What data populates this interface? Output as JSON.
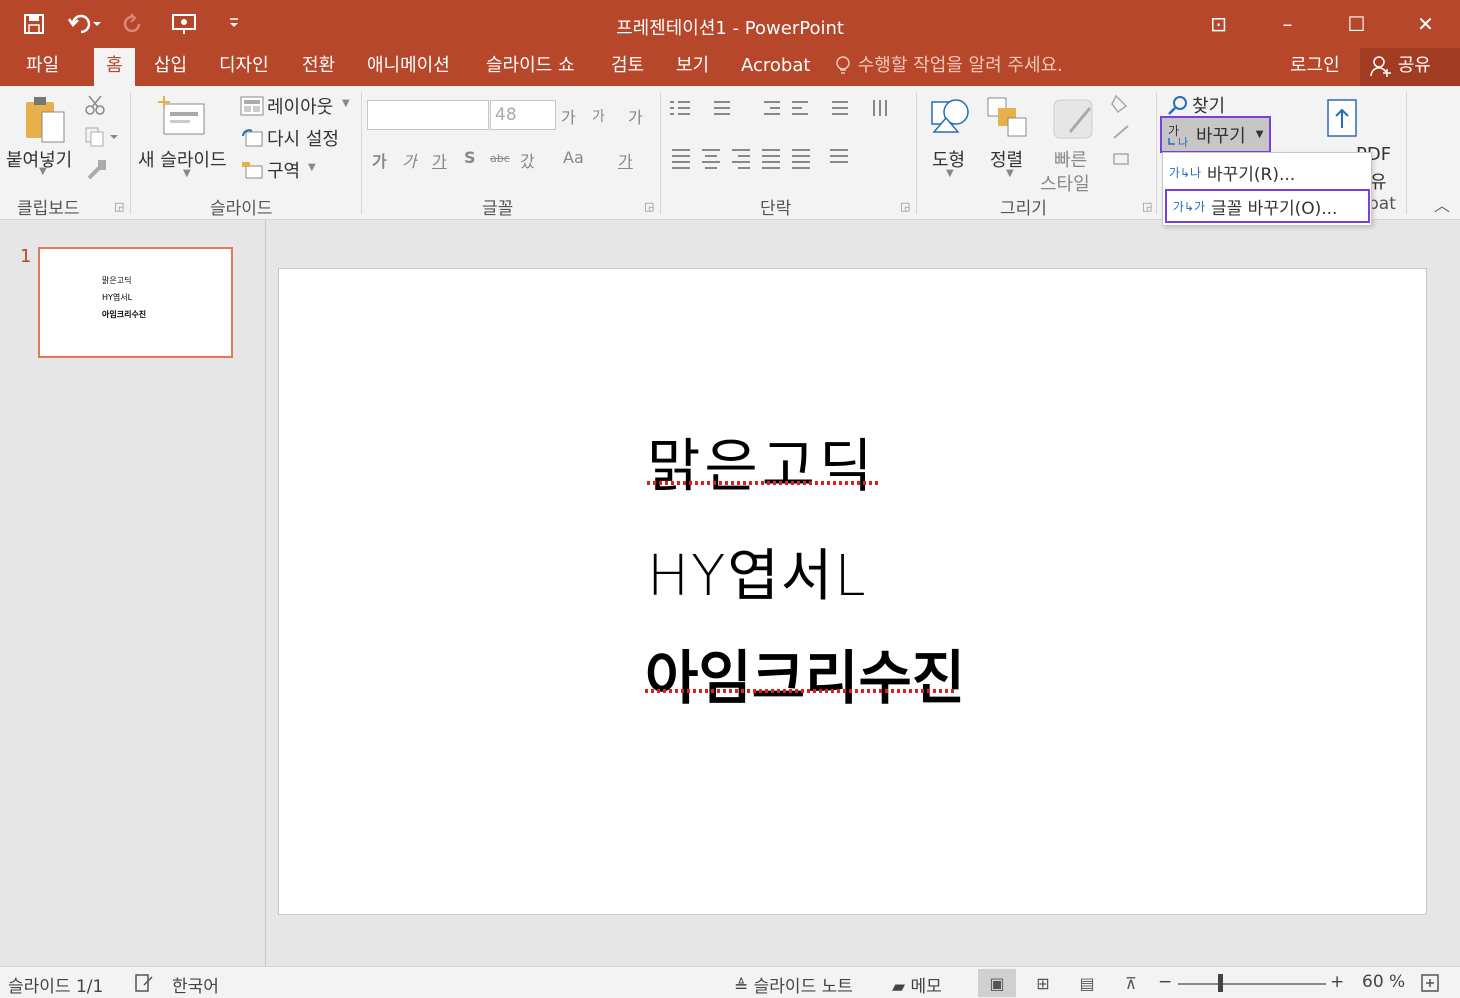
{
  "window": {
    "title": "프레젠테이션1 - PowerPoint",
    "min": "–",
    "max": "☐",
    "close": "✕",
    "ribbon_display": "⊡"
  },
  "tabs": [
    "파일",
    "홈",
    "삽입",
    "디자인",
    "전환",
    "애니메이션",
    "슬라이드 쇼",
    "검토",
    "보기",
    "Acrobat"
  ],
  "active_tab": "홈",
  "tell_me": "수행할 작업을 알려 주세요.",
  "login": "로그인",
  "share": "공유",
  "ribbon": {
    "clipboard": {
      "paste": "붙여넣기",
      "label": "클립보드"
    },
    "slides": {
      "new_slide": "새 슬라이드",
      "layout": "레이아웃",
      "reset": "다시 설정",
      "section": "구역",
      "label": "슬라이드"
    },
    "font": {
      "size": "48",
      "grow": "가",
      "shrink": "가",
      "clear": "가",
      "bold": "가",
      "italic": "가",
      "underline": "가",
      "shadow": "S",
      "strike": "abc",
      "spacing": "갔",
      "case": "Aa",
      "color": "가",
      "label": "글꼴"
    },
    "paragraph": {
      "label": "단락"
    },
    "drawing": {
      "shapes": "도형",
      "arrange": "정렬",
      "quick_styles_1": "빠른",
      "quick_styles_2": "스타일",
      "label": "그리기"
    },
    "editing": {
      "find": "찾기",
      "replace": "바꾸기"
    },
    "acrobat": {
      "pdf": "PDF",
      "share": "유",
      "label": "bat"
    }
  },
  "replace_menu": {
    "items": [
      {
        "label": "바꾸기(R)...",
        "icon": "replace-icon"
      },
      {
        "label": "글꼴 바꾸기(O)...",
        "icon": "replace-font-icon"
      }
    ]
  },
  "thumbnail": {
    "number": "1",
    "lines": [
      "맑은고딕",
      "HY엽서L",
      "아임크리수진"
    ]
  },
  "slide": {
    "lines": [
      "맑은고딕",
      "HY엽서L",
      "아임크리수진"
    ]
  },
  "status": {
    "slide": "슬라이드 1/1",
    "language": "한국어",
    "notes": "슬라이드 노트",
    "comments": "메모",
    "zoom": "60 %",
    "zoom_level": 0.6
  },
  "colors": {
    "accent": "#b7472a",
    "highlight": "#7a3fe0"
  }
}
